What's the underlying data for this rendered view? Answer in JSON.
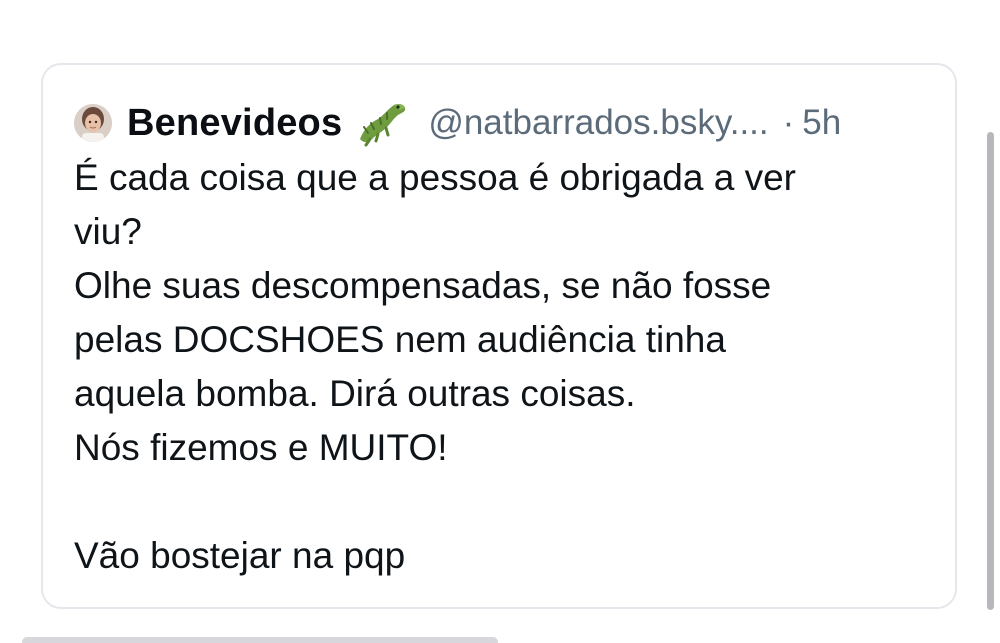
{
  "quote_post": {
    "author": {
      "display_name": "Benevideos",
      "emoji_icon": "crocodile-emoji",
      "handle": "@natbarrados.bsky....",
      "separator": "·",
      "time": "5h"
    },
    "text": "É cada coisa que a pessoa é obrigada a ver\nviu?\nOlhe suas descompensadas, se não fosse\npelas DOCSHOES nem audiência tinha\naquela bomba. Dirá outras coisas.\nNós fizemos e MUITO!\n\nVão bostejar na pqp"
  },
  "colors": {
    "border": "#e4e7eb",
    "text": "#0f1419",
    "muted": "#5c6b7a",
    "scrollbar": "#b8b8bc"
  }
}
